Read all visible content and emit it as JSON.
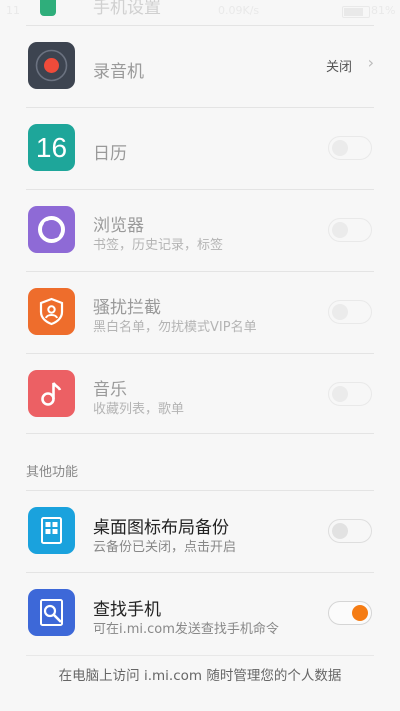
{
  "status_bar": {
    "network_speed": "0.09K/s",
    "battery_percent": "81%",
    "battery_level": 0.81
  },
  "top_partial": {
    "title": "手机设置"
  },
  "rows": [
    {
      "title": "录音机",
      "subtitle": "",
      "control": "link",
      "value": "关闭",
      "icon": "recorder-icon",
      "icon_color": "#3d4450"
    },
    {
      "title": "日历",
      "subtitle": "",
      "control": "toggle",
      "state": "off",
      "icon": "calendar-icon",
      "icon_color": "#1ea69a",
      "icon_text": "16"
    },
    {
      "title": "浏览器",
      "subtitle": "书签，历史记录，标签",
      "control": "toggle",
      "state": "off",
      "icon": "browser-icon",
      "icon_color": "#8e6ad6"
    },
    {
      "title": "骚扰拦截",
      "subtitle": "黑白名单，勿扰模式VIP名单",
      "control": "toggle",
      "state": "off",
      "icon": "harass-block-icon",
      "icon_color": "#ee6d2c"
    },
    {
      "title": "音乐",
      "subtitle": "收藏列表，歌单",
      "control": "toggle",
      "state": "off",
      "icon": "music-icon",
      "icon_color": "#ec6064"
    }
  ],
  "section_other": "其他功能",
  "other_rows": [
    {
      "title": "桌面图标布局备份",
      "subtitle": "云备份已关闭，点击开启",
      "control": "toggle",
      "state": "off",
      "icon": "desktop-backup-icon",
      "icon_color": "#1aa2dd"
    },
    {
      "title": "查找手机",
      "subtitle": "可在i.mi.com发送查找手机命令",
      "control": "toggle",
      "state": "on",
      "icon": "find-phone-icon",
      "icon_color": "#3d68d8"
    }
  ],
  "footer_text": "在电脑上访问 i.mi.com 随时管理您的个人数据"
}
